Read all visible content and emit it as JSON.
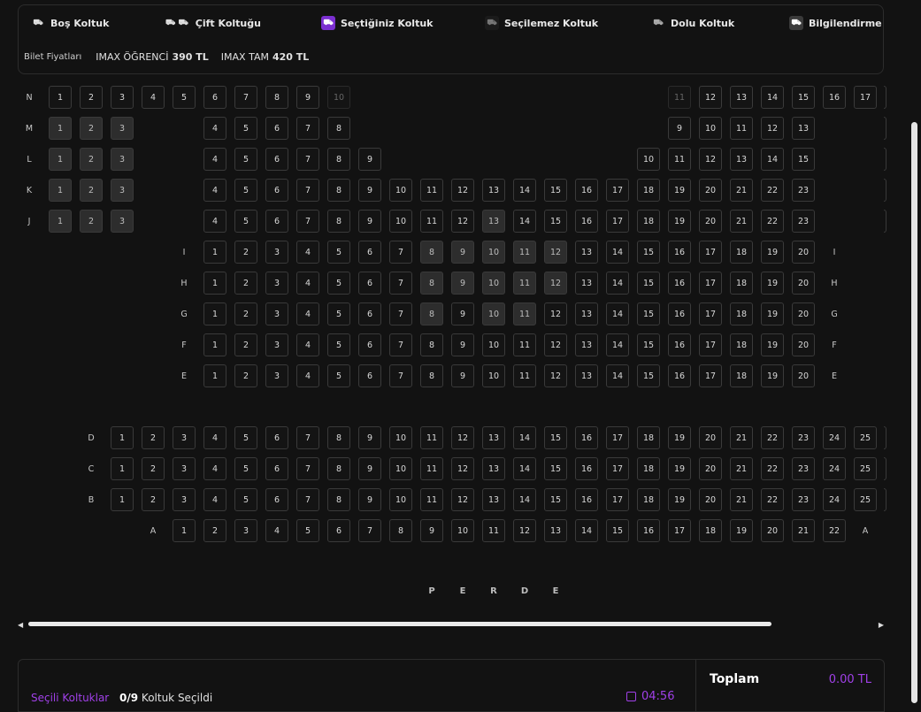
{
  "legend": {
    "empty_seat": "Boş Koltuk",
    "double_seat": "Çift Koltuğu",
    "selected_seat": "Seçtiğiniz Koltuk",
    "unselectable_seat": "Seçilemez Koltuk",
    "full_seat": "Dolu Koltuk",
    "info": "Bilgilendirme"
  },
  "prices": {
    "label": "Bilet Fiyatları",
    "items": [
      {
        "name": "IMAX ÖĞRENCİ",
        "value": "390 TL"
      },
      {
        "name": "IMAX TAM",
        "value": "420 TL"
      }
    ]
  },
  "seat_rows": [
    {
      "row": "N",
      "seats": [
        "1",
        "2",
        "3",
        "4",
        "5",
        "6",
        "7",
        "8",
        "9",
        "10",
        "11",
        "12",
        "13",
        "14",
        "15",
        "16",
        "17"
      ],
      "disabled": [
        "10",
        "11"
      ],
      "filled": []
    },
    {
      "row": "M",
      "seats": [
        "1",
        "2",
        "3",
        "4",
        "5",
        "6",
        "7",
        "8",
        "9",
        "10",
        "11",
        "12",
        "13"
      ],
      "disabled": [],
      "filled": [
        "1",
        "2",
        "3"
      ]
    },
    {
      "row": "L",
      "seats": [
        "1",
        "2",
        "3",
        "4",
        "5",
        "6",
        "7",
        "8",
        "9",
        "10",
        "11",
        "12",
        "13",
        "14",
        "15"
      ],
      "disabled": [],
      "filled": [
        "1",
        "2",
        "3"
      ]
    },
    {
      "row": "K",
      "seats": [
        "1",
        "2",
        "3",
        "4",
        "5",
        "6",
        "7",
        "8",
        "9",
        "10",
        "11",
        "12",
        "13",
        "14",
        "15",
        "16",
        "17",
        "18",
        "19",
        "20",
        "21",
        "22",
        "23"
      ],
      "disabled": [],
      "filled": [
        "1",
        "2",
        "3"
      ]
    },
    {
      "row": "J",
      "seats": [
        "1",
        "2",
        "3",
        "4",
        "5",
        "6",
        "7",
        "8",
        "9",
        "10",
        "11",
        "12",
        "13",
        "14",
        "15",
        "16",
        "17",
        "18",
        "19",
        "20",
        "21",
        "22",
        "23"
      ],
      "disabled": [],
      "filled": [
        "1",
        "2",
        "3",
        "13"
      ]
    },
    {
      "row": "I",
      "seats": [
        "1",
        "2",
        "3",
        "4",
        "5",
        "6",
        "7",
        "8",
        "9",
        "10",
        "11",
        "12",
        "13",
        "14",
        "15",
        "16",
        "17",
        "18",
        "19",
        "20"
      ],
      "disabled": [],
      "filled": [
        "8",
        "9",
        "10",
        "11",
        "12"
      ]
    },
    {
      "row": "H",
      "seats": [
        "1",
        "2",
        "3",
        "4",
        "5",
        "6",
        "7",
        "8",
        "9",
        "10",
        "11",
        "12",
        "13",
        "14",
        "15",
        "16",
        "17",
        "18",
        "19",
        "20"
      ],
      "disabled": [],
      "filled": [
        "8",
        "9",
        "10",
        "11",
        "12"
      ]
    },
    {
      "row": "G",
      "seats": [
        "1",
        "2",
        "3",
        "4",
        "5",
        "6",
        "7",
        "8",
        "9",
        "10",
        "11",
        "12",
        "13",
        "14",
        "15",
        "16",
        "17",
        "18",
        "19",
        "20"
      ],
      "disabled": [],
      "filled": [
        "8",
        "10",
        "11"
      ]
    },
    {
      "row": "F",
      "seats": [
        "1",
        "2",
        "3",
        "4",
        "5",
        "6",
        "7",
        "8",
        "9",
        "10",
        "11",
        "12",
        "13",
        "14",
        "15",
        "16",
        "17",
        "18",
        "19",
        "20"
      ],
      "disabled": [],
      "filled": []
    },
    {
      "row": "E",
      "seats": [
        "1",
        "2",
        "3",
        "4",
        "5",
        "6",
        "7",
        "8",
        "9",
        "10",
        "11",
        "12",
        "13",
        "14",
        "15",
        "16",
        "17",
        "18",
        "19",
        "20"
      ],
      "disabled": [],
      "filled": []
    },
    {
      "row": "D",
      "seats": [
        "1",
        "2",
        "3",
        "4",
        "5",
        "6",
        "7",
        "8",
        "9",
        "10",
        "11",
        "12",
        "13",
        "14",
        "15",
        "16",
        "17",
        "18",
        "19",
        "20",
        "21",
        "22",
        "23",
        "24",
        "25"
      ],
      "disabled": [],
      "filled": []
    },
    {
      "row": "C",
      "seats": [
        "1",
        "2",
        "3",
        "4",
        "5",
        "6",
        "7",
        "8",
        "9",
        "10",
        "11",
        "12",
        "13",
        "14",
        "15",
        "16",
        "17",
        "18",
        "19",
        "20",
        "21",
        "22",
        "23",
        "24",
        "25"
      ],
      "disabled": [],
      "filled": []
    },
    {
      "row": "B",
      "seats": [
        "1",
        "2",
        "3",
        "4",
        "5",
        "6",
        "7",
        "8",
        "9",
        "10",
        "11",
        "12",
        "13",
        "14",
        "15",
        "16",
        "17",
        "18",
        "19",
        "20",
        "21",
        "22",
        "23",
        "24",
        "25"
      ],
      "disabled": [],
      "filled": []
    },
    {
      "row": "A",
      "seats": [
        "1",
        "2",
        "3",
        "4",
        "5",
        "6",
        "7",
        "8",
        "9",
        "10",
        "11",
        "12",
        "13",
        "14",
        "15",
        "16",
        "17",
        "18",
        "19",
        "20",
        "21",
        "22"
      ],
      "disabled": [],
      "filled": []
    }
  ],
  "screen_label": [
    "P",
    "E",
    "R",
    "D",
    "E"
  ],
  "footer": {
    "selected_label": "Seçili Koltuklar",
    "selected_count": "0/9",
    "selected_suffix": "Koltuk Seçildi",
    "timer": "04:56",
    "total_label": "Toplam",
    "total_value": "0.00 TL"
  },
  "colors": {
    "accent": "#a040e8",
    "selected_icon_bg": "#7b2fd0",
    "background": "#121212"
  }
}
